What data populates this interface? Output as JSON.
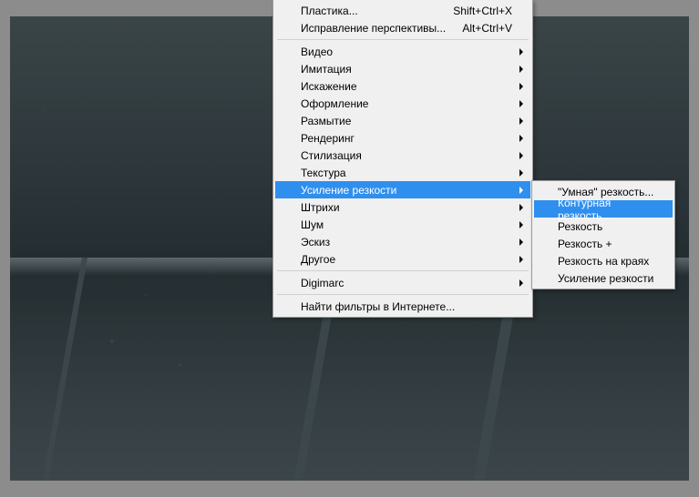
{
  "menu": {
    "top": [
      {
        "label": "Пластика...",
        "shortcut": "Shift+Ctrl+X"
      },
      {
        "label": "Исправление перспективы...",
        "shortcut": "Alt+Ctrl+V"
      }
    ],
    "middle": [
      {
        "label": "Видео"
      },
      {
        "label": "Имитация"
      },
      {
        "label": "Искажение"
      },
      {
        "label": "Оформление"
      },
      {
        "label": "Размытие"
      },
      {
        "label": "Рендеринг"
      },
      {
        "label": "Стилизация"
      },
      {
        "label": "Текстура"
      },
      {
        "label": "Усиление резкости",
        "highlighted": true
      },
      {
        "label": "Штрихи"
      },
      {
        "label": "Шум"
      },
      {
        "label": "Эскиз"
      },
      {
        "label": "Другое"
      }
    ],
    "digimarc": {
      "label": "Digimarc"
    },
    "bottom": {
      "label": "Найти фильтры в Интернете..."
    }
  },
  "submenu": [
    {
      "label": "\"Умная\" резкость..."
    },
    {
      "label": "Контурная резкость...",
      "highlighted": true
    },
    {
      "label": "Резкость"
    },
    {
      "label": "Резкость +"
    },
    {
      "label": "Резкость на краях"
    },
    {
      "label": "Усиление резкости"
    }
  ]
}
